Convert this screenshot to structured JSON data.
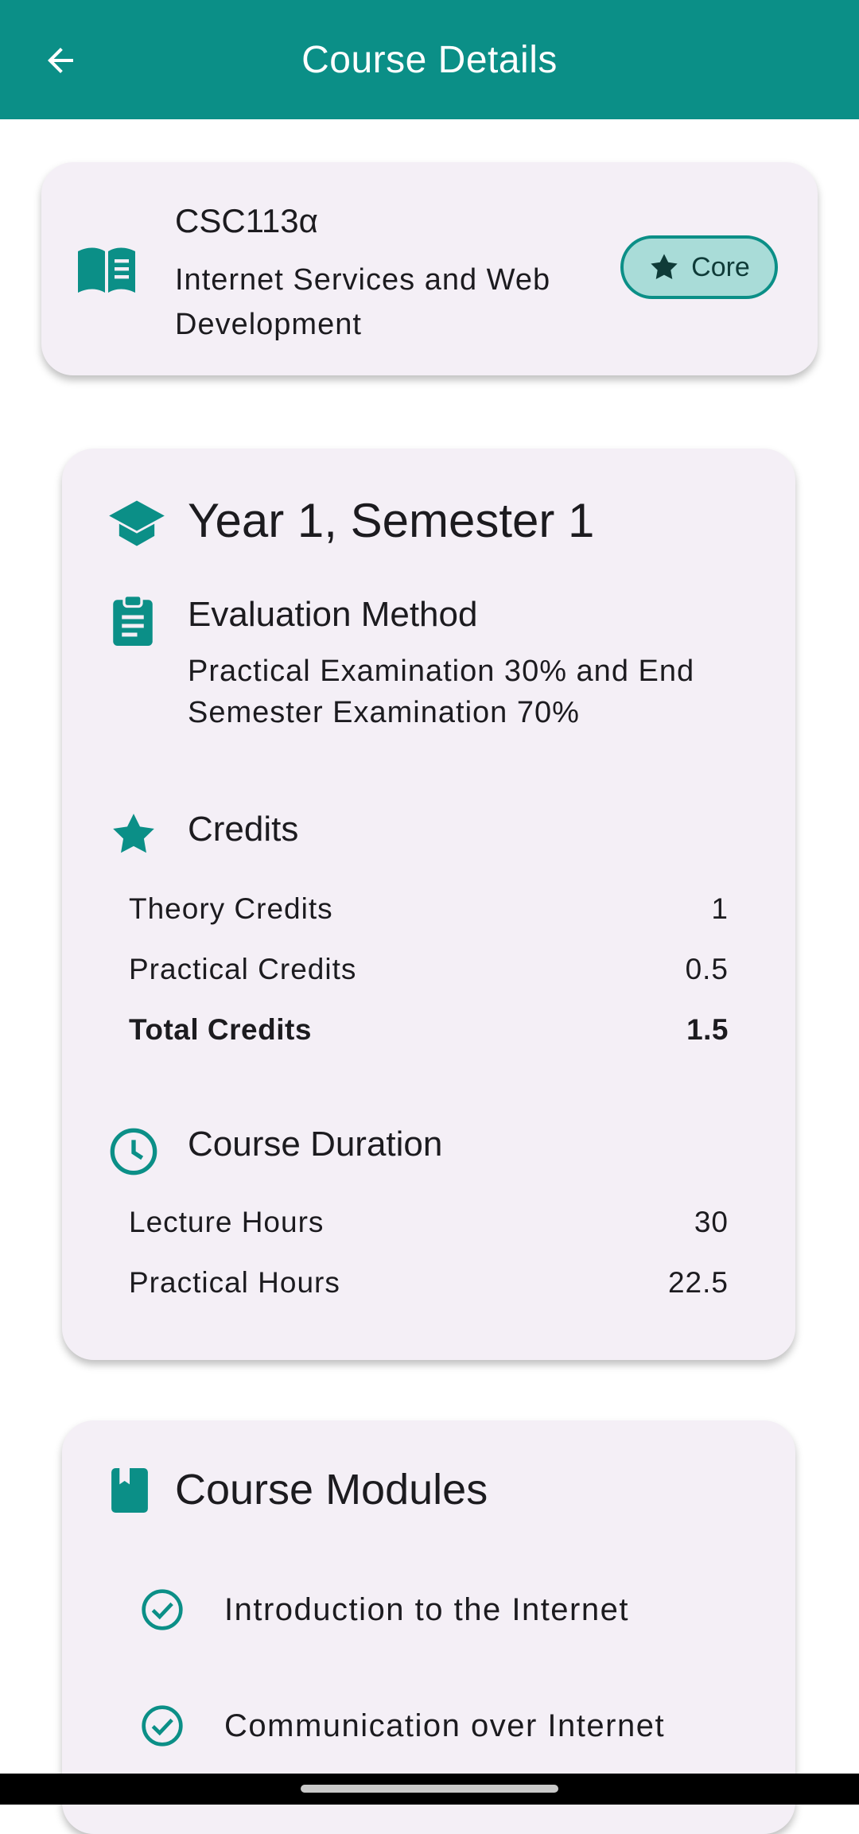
{
  "appbar": {
    "title": "Course Details",
    "back_icon": "arrow-back-icon"
  },
  "course": {
    "code": "CSC113α",
    "name": " Internet Services and Web Development",
    "badge": "Core",
    "icon": "menu-book-icon"
  },
  "details": {
    "semester": "Year 1, Semester 1",
    "evaluation": {
      "title": "Evaluation Method",
      "text": "Practical Examination 30% and End Semester Examination 70%"
    },
    "credits": {
      "title": "Credits",
      "rows": [
        {
          "label": "Theory Credits",
          "value": "1"
        },
        {
          "label": "Practical Credits",
          "value": "0.5"
        },
        {
          "label": "Total Credits",
          "value": "1.5"
        }
      ]
    },
    "duration": {
      "title": "Course Duration",
      "rows": [
        {
          "label": "Lecture Hours",
          "value": "30"
        },
        {
          "label": "Practical Hours",
          "value": "22.5"
        }
      ]
    }
  },
  "modules": {
    "title": "Course Modules",
    "items": [
      {
        "label": "Introduction to the Internet"
      },
      {
        "label": "Communication over Internet"
      }
    ]
  },
  "colors": {
    "primary": "#0b8f87",
    "card": "#f4eff6",
    "badge_bg": "#a9dcd8"
  }
}
